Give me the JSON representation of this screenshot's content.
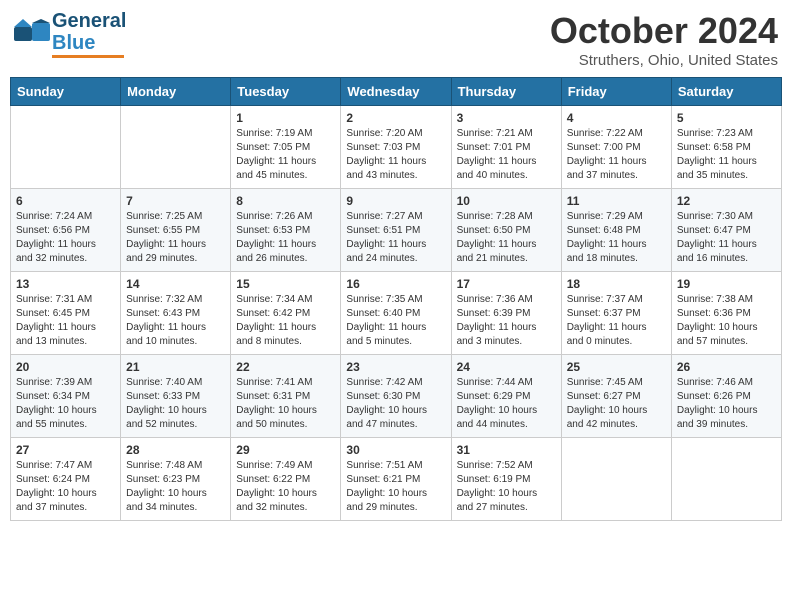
{
  "header": {
    "logo_general": "General",
    "logo_blue": "Blue",
    "title": "October 2024",
    "location": "Struthers, Ohio, United States"
  },
  "days_of_week": [
    "Sunday",
    "Monday",
    "Tuesday",
    "Wednesday",
    "Thursday",
    "Friday",
    "Saturday"
  ],
  "weeks": [
    [
      {
        "day": "",
        "content": ""
      },
      {
        "day": "",
        "content": ""
      },
      {
        "day": "1",
        "content": "Sunrise: 7:19 AM\nSunset: 7:05 PM\nDaylight: 11 hours and 45 minutes."
      },
      {
        "day": "2",
        "content": "Sunrise: 7:20 AM\nSunset: 7:03 PM\nDaylight: 11 hours and 43 minutes."
      },
      {
        "day": "3",
        "content": "Sunrise: 7:21 AM\nSunset: 7:01 PM\nDaylight: 11 hours and 40 minutes."
      },
      {
        "day": "4",
        "content": "Sunrise: 7:22 AM\nSunset: 7:00 PM\nDaylight: 11 hours and 37 minutes."
      },
      {
        "day": "5",
        "content": "Sunrise: 7:23 AM\nSunset: 6:58 PM\nDaylight: 11 hours and 35 minutes."
      }
    ],
    [
      {
        "day": "6",
        "content": "Sunrise: 7:24 AM\nSunset: 6:56 PM\nDaylight: 11 hours and 32 minutes."
      },
      {
        "day": "7",
        "content": "Sunrise: 7:25 AM\nSunset: 6:55 PM\nDaylight: 11 hours and 29 minutes."
      },
      {
        "day": "8",
        "content": "Sunrise: 7:26 AM\nSunset: 6:53 PM\nDaylight: 11 hours and 26 minutes."
      },
      {
        "day": "9",
        "content": "Sunrise: 7:27 AM\nSunset: 6:51 PM\nDaylight: 11 hours and 24 minutes."
      },
      {
        "day": "10",
        "content": "Sunrise: 7:28 AM\nSunset: 6:50 PM\nDaylight: 11 hours and 21 minutes."
      },
      {
        "day": "11",
        "content": "Sunrise: 7:29 AM\nSunset: 6:48 PM\nDaylight: 11 hours and 18 minutes."
      },
      {
        "day": "12",
        "content": "Sunrise: 7:30 AM\nSunset: 6:47 PM\nDaylight: 11 hours and 16 minutes."
      }
    ],
    [
      {
        "day": "13",
        "content": "Sunrise: 7:31 AM\nSunset: 6:45 PM\nDaylight: 11 hours and 13 minutes."
      },
      {
        "day": "14",
        "content": "Sunrise: 7:32 AM\nSunset: 6:43 PM\nDaylight: 11 hours and 10 minutes."
      },
      {
        "day": "15",
        "content": "Sunrise: 7:34 AM\nSunset: 6:42 PM\nDaylight: 11 hours and 8 minutes."
      },
      {
        "day": "16",
        "content": "Sunrise: 7:35 AM\nSunset: 6:40 PM\nDaylight: 11 hours and 5 minutes."
      },
      {
        "day": "17",
        "content": "Sunrise: 7:36 AM\nSunset: 6:39 PM\nDaylight: 11 hours and 3 minutes."
      },
      {
        "day": "18",
        "content": "Sunrise: 7:37 AM\nSunset: 6:37 PM\nDaylight: 11 hours and 0 minutes."
      },
      {
        "day": "19",
        "content": "Sunrise: 7:38 AM\nSunset: 6:36 PM\nDaylight: 10 hours and 57 minutes."
      }
    ],
    [
      {
        "day": "20",
        "content": "Sunrise: 7:39 AM\nSunset: 6:34 PM\nDaylight: 10 hours and 55 minutes."
      },
      {
        "day": "21",
        "content": "Sunrise: 7:40 AM\nSunset: 6:33 PM\nDaylight: 10 hours and 52 minutes."
      },
      {
        "day": "22",
        "content": "Sunrise: 7:41 AM\nSunset: 6:31 PM\nDaylight: 10 hours and 50 minutes."
      },
      {
        "day": "23",
        "content": "Sunrise: 7:42 AM\nSunset: 6:30 PM\nDaylight: 10 hours and 47 minutes."
      },
      {
        "day": "24",
        "content": "Sunrise: 7:44 AM\nSunset: 6:29 PM\nDaylight: 10 hours and 44 minutes."
      },
      {
        "day": "25",
        "content": "Sunrise: 7:45 AM\nSunset: 6:27 PM\nDaylight: 10 hours and 42 minutes."
      },
      {
        "day": "26",
        "content": "Sunrise: 7:46 AM\nSunset: 6:26 PM\nDaylight: 10 hours and 39 minutes."
      }
    ],
    [
      {
        "day": "27",
        "content": "Sunrise: 7:47 AM\nSunset: 6:24 PM\nDaylight: 10 hours and 37 minutes."
      },
      {
        "day": "28",
        "content": "Sunrise: 7:48 AM\nSunset: 6:23 PM\nDaylight: 10 hours and 34 minutes."
      },
      {
        "day": "29",
        "content": "Sunrise: 7:49 AM\nSunset: 6:22 PM\nDaylight: 10 hours and 32 minutes."
      },
      {
        "day": "30",
        "content": "Sunrise: 7:51 AM\nSunset: 6:21 PM\nDaylight: 10 hours and 29 minutes."
      },
      {
        "day": "31",
        "content": "Sunrise: 7:52 AM\nSunset: 6:19 PM\nDaylight: 10 hours and 27 minutes."
      },
      {
        "day": "",
        "content": ""
      },
      {
        "day": "",
        "content": ""
      }
    ]
  ]
}
